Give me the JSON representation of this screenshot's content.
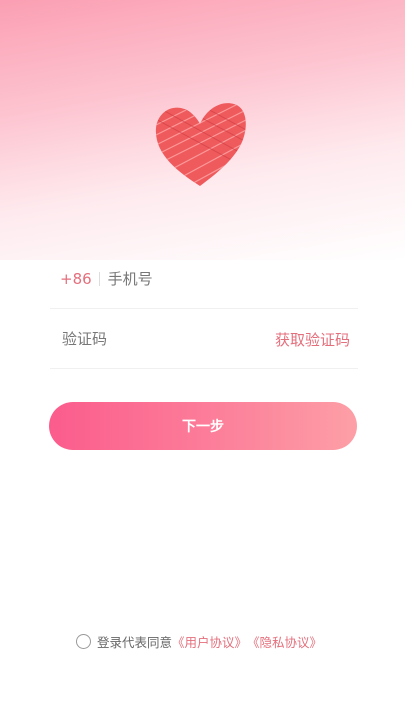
{
  "phone": {
    "country_code": "+86",
    "placeholder": "手机号",
    "value": ""
  },
  "code": {
    "placeholder": "验证码",
    "value": "",
    "get_code_label": "获取验证码"
  },
  "next_button_label": "下一步",
  "agreement": {
    "text": "登录代表同意",
    "user_agreement": "《用户协议》",
    "privacy_agreement": "《隐私协议》",
    "checked": false
  },
  "colors": {
    "accent": "#e46f7c",
    "button_start": "#fb5c8c",
    "button_end": "#fd9fa6",
    "heart": "#e8454a"
  },
  "icons": {
    "logo": "heart-icon"
  }
}
